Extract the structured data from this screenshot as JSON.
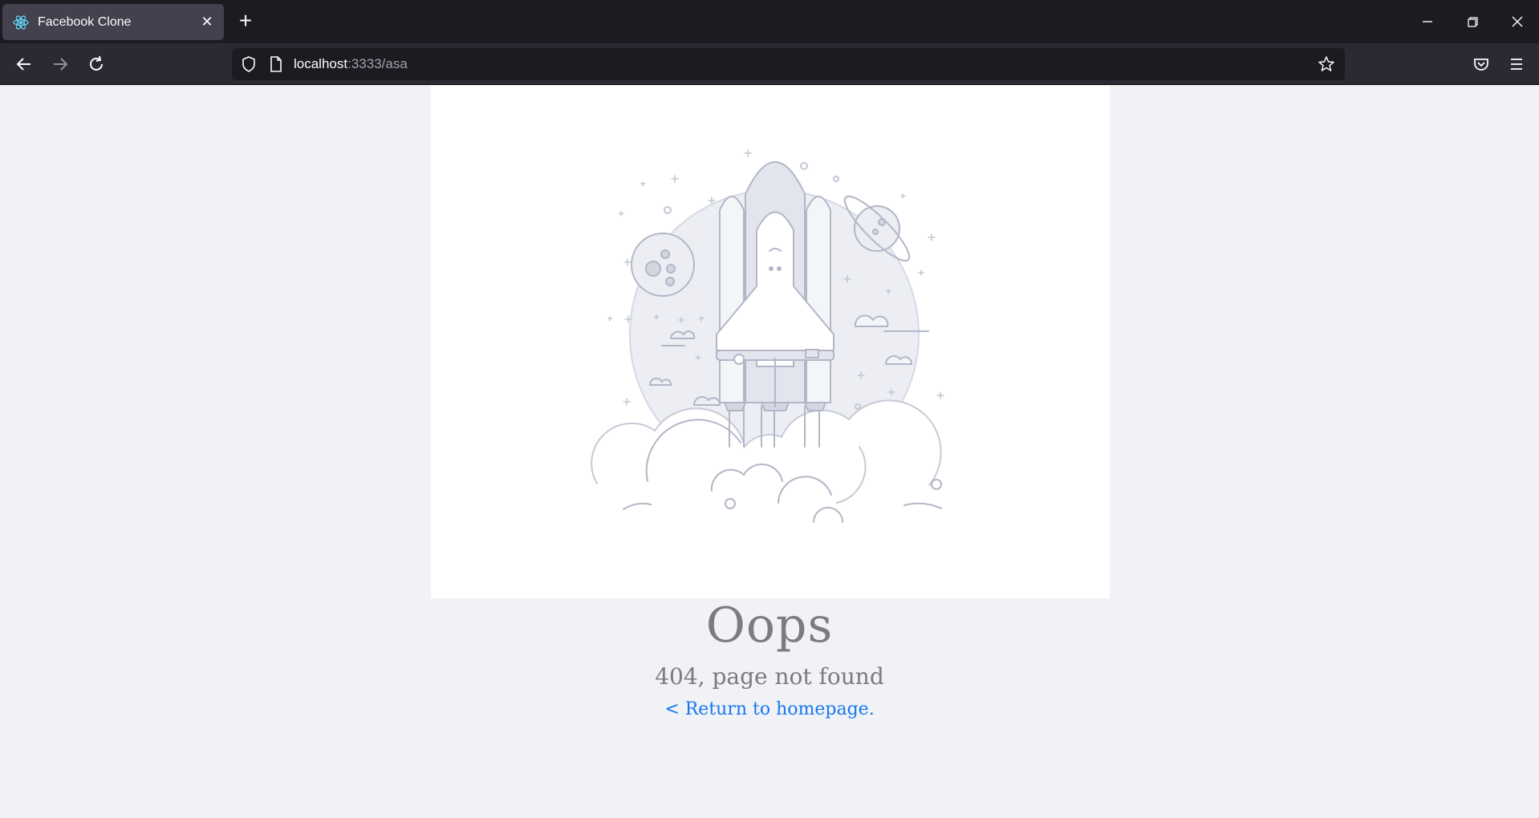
{
  "browser": {
    "tab_title": "Facebook Clone",
    "tab_close": "✕",
    "new_tab": "+",
    "url_host": "localhost",
    "url_rest": ":3333/asa"
  },
  "error": {
    "heading": "Oops",
    "message": "404, page not found",
    "link_text": "< Return to homepage."
  },
  "colors": {
    "page_background": "#f0f2f5",
    "link": "#1877f2",
    "text_muted": "#7b7b80"
  },
  "icons": [
    "react-favicon-icon",
    "close-icon",
    "plus-icon",
    "minimize-icon",
    "restore-icon",
    "close-window-icon",
    "back-arrow-icon",
    "forward-arrow-icon",
    "reload-icon",
    "shield-icon",
    "page-icon",
    "star-icon",
    "pocket-icon",
    "hamburger-menu-icon"
  ]
}
